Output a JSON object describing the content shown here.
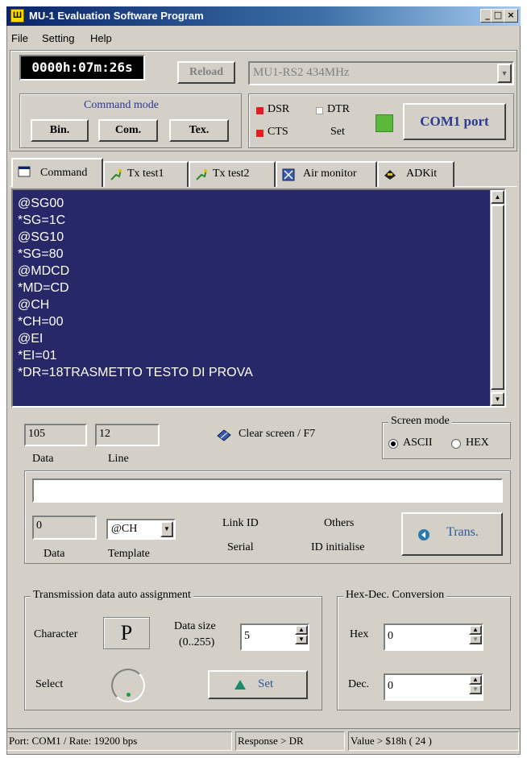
{
  "window": {
    "title": "MU-1 Evaluation Software Program",
    "icon_glyph": "Ш"
  },
  "title_buttons": {
    "minimize": "_",
    "maximize": "□",
    "close": "×"
  },
  "menu": [
    "File",
    "Setting",
    "Help"
  ],
  "toolbar": {
    "timer": "0000h:07m:26s",
    "reload": "Reload",
    "device_select": "MU1-RS2   434MHz",
    "command_mode_label": "Command mode",
    "mode_buttons": [
      "Bin.",
      "Com.",
      "Tex."
    ],
    "signals": {
      "dsr": "DSR",
      "dtr": "DTR",
      "cts": "CTS",
      "set": "Set"
    },
    "com_port": "COM1 port",
    "colors": {
      "indicator_on": "#e02020",
      "port_ok": "#5ab83c"
    }
  },
  "tabs": [
    {
      "label": "Command",
      "icon": "command-window-icon"
    },
    {
      "label": "Tx test1",
      "icon": "tx-test-icon"
    },
    {
      "label": "Tx test2",
      "icon": "tx-test-icon"
    },
    {
      "label": "Air monitor",
      "icon": "air-monitor-icon"
    },
    {
      "label": "ADKit",
      "icon": "adkit-icon"
    }
  ],
  "console": {
    "lines": [
      "@SG00",
      "*SG=1C",
      "@SG10",
      "*SG=80",
      "@MDCD",
      "*MD=CD",
      "@CH",
      "*CH=00",
      "@EI",
      "*EI=01",
      "*DR=18TRASMETTO TESTO DI PROVA"
    ],
    "background": "#262868"
  },
  "stats": {
    "data_value": "105",
    "data_label": "Data",
    "line_value": "12",
    "line_label": "Line",
    "clear_screen": "Clear screen / F7",
    "screen_mode_title": "Screen mode",
    "ascii": "ASCII",
    "hex": "HEX"
  },
  "send": {
    "input_value": "",
    "data_value": "0",
    "data_label": "Data",
    "template_value": "@CH",
    "template_label": "Template",
    "link_id": "Link ID",
    "serial": "Serial",
    "others": "Others",
    "id_initialise": "ID initialise",
    "trans": "Trans."
  },
  "auto_assign": {
    "title": "Transmission data auto assignment",
    "character_label": "Character",
    "character_value": "P",
    "data_size_label": "Data size",
    "data_size_range": "(0..255)",
    "data_size_value": "5",
    "select_label": "Select",
    "set_button": "Set"
  },
  "hexdec": {
    "title": "Hex-Dec. Conversion",
    "hex_label": "Hex",
    "hex_value": "0",
    "dec_label": "Dec.",
    "dec_value": "0"
  },
  "statusbar": {
    "port": "Port: COM1 / Rate: 19200 bps",
    "response": "Response > DR",
    "value": "Value > $18h ( 24 )"
  }
}
